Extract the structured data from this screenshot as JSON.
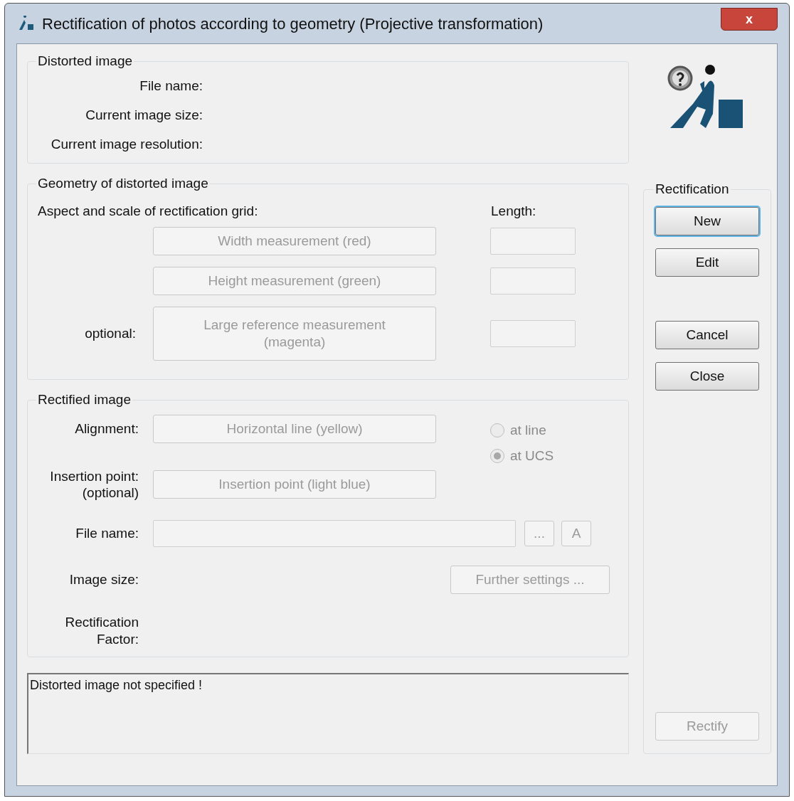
{
  "window": {
    "title": "Rectification of photos according to geometry (Projective transformation)",
    "close": "x"
  },
  "distorted_image": {
    "title": "Distorted image",
    "labels": [
      "File name:",
      "Current image size:",
      "Current image resolution:"
    ]
  },
  "geometry": {
    "title": "Geometry of distorted image",
    "aspect_label": "Aspect and scale of rectification grid:",
    "length_label": "Length:",
    "rows": [
      {
        "label": "",
        "button": "Width measurement (red)",
        "disabled": true
      },
      {
        "label": "",
        "button": "Height measurement (green)",
        "disabled": true
      },
      {
        "label": "optional:",
        "button": "Large reference measurement\n(magenta)",
        "disabled": true
      }
    ]
  },
  "rectified_image": {
    "title": "Rectified image",
    "alignment_label": "Alignment:",
    "alignment_button": "Horizontal line (yellow)",
    "radios": [
      {
        "label": "at line",
        "selected": false,
        "disabled": true
      },
      {
        "label": "at UCS",
        "selected": true,
        "disabled": true
      }
    ],
    "insertion_label": "Insertion point:\n(optional)",
    "insertion_button": "Insertion point (light blue)",
    "file_label": "File name:",
    "browse_button": "...",
    "a_button": "A",
    "size_label": "Image size:",
    "further_button": "Further settings ...",
    "factor_label": "Rectification\nFactor:"
  },
  "status": "Distorted image not specified !",
  "rectification": {
    "title": "Rectification",
    "buttons": [
      {
        "label": "New",
        "focused": true,
        "disabled": false
      },
      {
        "label": "Edit",
        "focused": false,
        "disabled": false
      },
      {
        "label": "Cancel",
        "focused": false,
        "disabled": false
      },
      {
        "label": "Close",
        "focused": false,
        "disabled": false
      },
      {
        "label": "Rectify",
        "focused": false,
        "disabled": true
      }
    ]
  }
}
